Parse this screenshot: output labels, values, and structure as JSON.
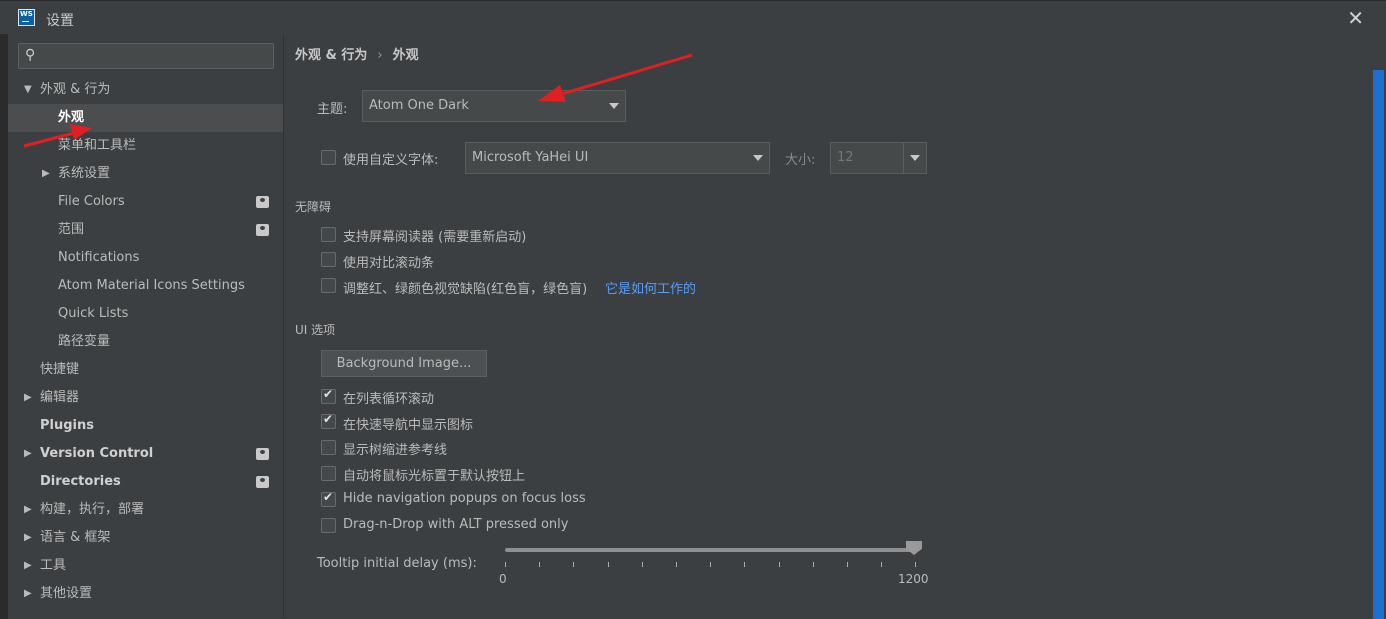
{
  "window": {
    "title": "设置",
    "logo_text": "WS",
    "close_glyph": "✕"
  },
  "search": {
    "placeholder": ""
  },
  "sidebar": {
    "items": [
      {
        "label": "外观 & 行为",
        "expanded": true
      },
      {
        "label": "外观"
      },
      {
        "label": "菜单和工具栏"
      },
      {
        "label": "系统设置"
      },
      {
        "label": "File Colors"
      },
      {
        "label": "范围"
      },
      {
        "label": "Notifications"
      },
      {
        "label": "Atom Material Icons Settings"
      },
      {
        "label": "Quick Lists"
      },
      {
        "label": "路径变量"
      },
      {
        "label": "快捷键"
      },
      {
        "label": "编辑器"
      },
      {
        "label": "Plugins"
      },
      {
        "label": "Version Control"
      },
      {
        "label": "Directories"
      },
      {
        "label": "构建，执行，部署"
      },
      {
        "label": "语言 & 框架"
      },
      {
        "label": "工具"
      },
      {
        "label": "其他设置"
      }
    ]
  },
  "breadcrumb": {
    "parent": "外观 & 行为",
    "separator": "›",
    "current": "外观"
  },
  "theme": {
    "label": "主题:",
    "value": "Atom One Dark"
  },
  "font": {
    "label": "使用自定义字体:",
    "value": "Microsoft YaHei UI",
    "size_label": "大小:",
    "size_value": "12",
    "checked": false
  },
  "accessibility": {
    "title": "无障碍",
    "options": [
      {
        "label": "支持屏幕阅读器 (需要重新启动)",
        "checked": false
      },
      {
        "label": "使用对比滚动条",
        "checked": false
      },
      {
        "label": "调整红、绿颜色视觉缺陷(红色盲，绿色盲)",
        "checked": false,
        "link": "它是如何工作的"
      }
    ]
  },
  "ui_options": {
    "title": "UI 选项",
    "background_button": "Background Image...",
    "options": [
      {
        "label": "在列表循环滚动",
        "checked": true
      },
      {
        "label": "在快速导航中显示图标",
        "checked": true
      },
      {
        "label": "显示树缩进参考线",
        "checked": false
      },
      {
        "label": "自动将鼠标光标置于默认按钮上",
        "checked": false
      },
      {
        "label": "Hide navigation popups on focus loss",
        "checked": true
      },
      {
        "label": "Drag-n-Drop with ALT pressed only",
        "checked": false
      }
    ]
  },
  "tooltip": {
    "label": "Tooltip initial delay (ms):",
    "min": "0",
    "max": "1200",
    "value": 1200
  },
  "colors": {
    "accent": "#589df6",
    "scroll": "#1f6fd1",
    "annotation": "#e02020"
  }
}
